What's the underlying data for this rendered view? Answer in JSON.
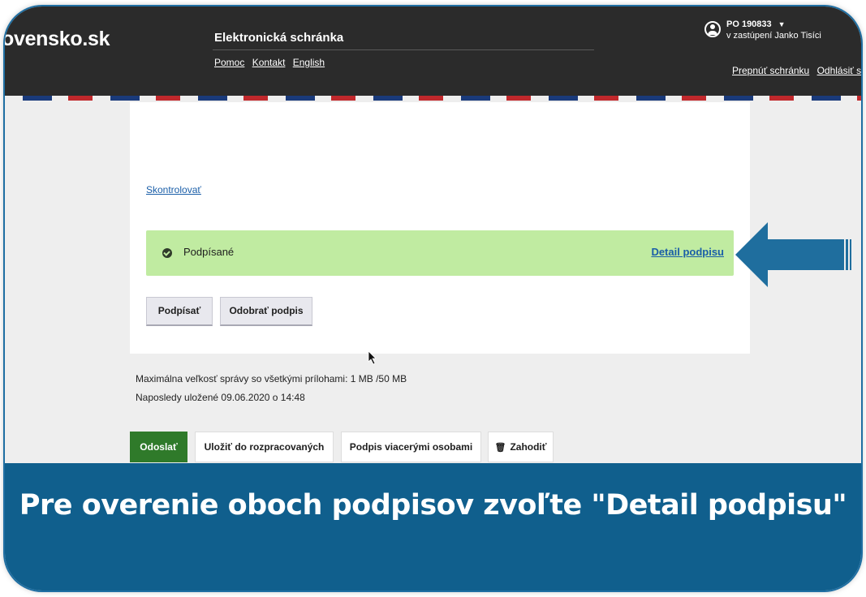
{
  "header": {
    "logo": "ovensko.sk",
    "app_title": "Elektronická schránka",
    "links": [
      "Pomoc",
      "Kontakt",
      "English"
    ],
    "account": {
      "id": "PO 190833",
      "represented": "v zastúpení Janko Tisíci",
      "switch_link": "Prepnúť schránku",
      "logout_link": "Odhlásiť sa"
    }
  },
  "card": {
    "check_link": "Skontrolovať",
    "signature": {
      "status": "Podpísané",
      "detail_link": "Detail podpisu"
    },
    "buttons": {
      "sign": "Podpísať",
      "remove_signature": "Odobrať podpis"
    }
  },
  "info": {
    "max_size": "Maximálna veľkosť správy so všetkými prílohami: 1 MB /50 MB",
    "last_saved": "Naposledy uložené 09.06.2020 o 14:48"
  },
  "actions": {
    "send": "Odoslať",
    "save_draft": "Uložiť do rozpracovaných",
    "multi_sign": "Podpis viacerými osobami",
    "discard": "Zahodiť"
  },
  "banner": {
    "text": "Pre overenie oboch podpisov zvoľte \"Detail podpisu\""
  },
  "colors": {
    "header_bg": "#2b2b2b",
    "success_bg": "#c0eba1",
    "send_button": "#2f7a2a",
    "banner_bg": "#105f8d",
    "arrow": "#1f6e9e",
    "link": "#1a5ea8"
  }
}
